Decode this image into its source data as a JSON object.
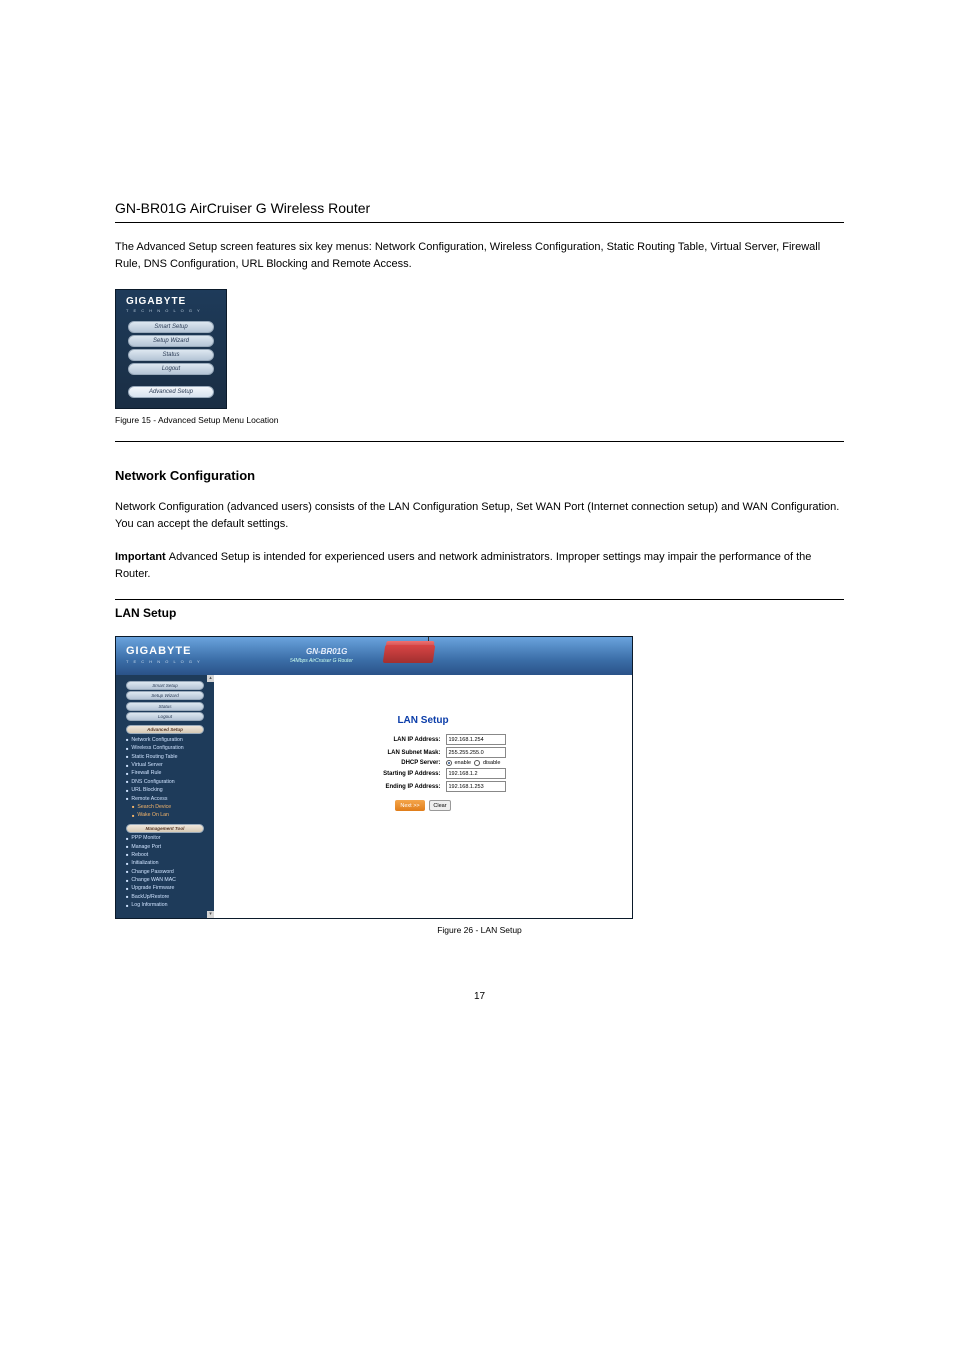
{
  "chapter_header": "GN-BR01G AirCruiser G Wireless Router",
  "intro_body_1": "The Advanced Setup screen features six key menus: Network Configuration, Wireless Configuration, Static Routing Table, Virtual Server, Firewall Rule, DNS Configuration, URL Blocking and Remote Access.",
  "caption1": "Figure 15 - Advanced Setup Menu Location",
  "section_title": "Network Configuration",
  "section_body": "Network Configuration (advanced users) consists of the LAN Configuration Setup, Set WAN Port (Internet connection setup) and WAN Configuration. You can accept the default settings.",
  "section_note_label": "Important ",
  "section_note": "Advanced Setup is intended for experienced users and network administrators. Improper settings may impair the performance of the Router.",
  "subsection_title": "LAN Setup",
  "caption2": "Figure 26 - LAN Setup",
  "page_num": "17",
  "brand": "GIGABYTE",
  "brand_sub": "T E C H N O L O G Y",
  "nav": {
    "smart_setup": "Smart Setup",
    "setup_wizard": "Setup Wizard",
    "status": "Status",
    "logout": "Logout",
    "advanced_setup": "Advanced Setup"
  },
  "model": "GN-BR01G",
  "model_sub": "54Mbps AirCruiser G Router",
  "side_links": {
    "management_tool": "Management Tool",
    "network_configuration": "Network Configuration",
    "wireless_configuration": "Wireless Configuration",
    "static_routing_table": "Static Routing Table",
    "virtual_server": "Virtual Server",
    "firewall_rule": "Firewall Rule",
    "dns_configuration": "DNS Configuration",
    "url_blocking": "URL Blocking",
    "remote_access": "Remote Access",
    "search_device": "Search Device",
    "wake_on_lan": "Wake On Lan",
    "ppp_monitor": "PPP Monitor",
    "manage_port": "Manage Port",
    "reboot": "Reboot",
    "initialization": "Initialization",
    "change_password": "Change Password",
    "change_wan_mac": "Change WAN MAC",
    "upgrade_firmware": "Upgrade Firmware",
    "backup_restore": "BackUp/Restore",
    "log_information": "Log Information"
  },
  "lan": {
    "title": "LAN Setup",
    "lan_ip_label": "LAN IP Address:",
    "lan_ip": "192.168.1.254",
    "subnet_label": "LAN Subnet Mask:",
    "subnet": "255.255.255.0",
    "dhcp_label": "DHCP Server:",
    "enable": "enable",
    "disable": "disable",
    "start_ip_label": "Starting IP Address:",
    "start_ip": "192.168.1.2",
    "end_ip_label": "Ending IP Address:",
    "end_ip": "192.168.1.253",
    "next": "Next >>",
    "clear": "Clear"
  }
}
